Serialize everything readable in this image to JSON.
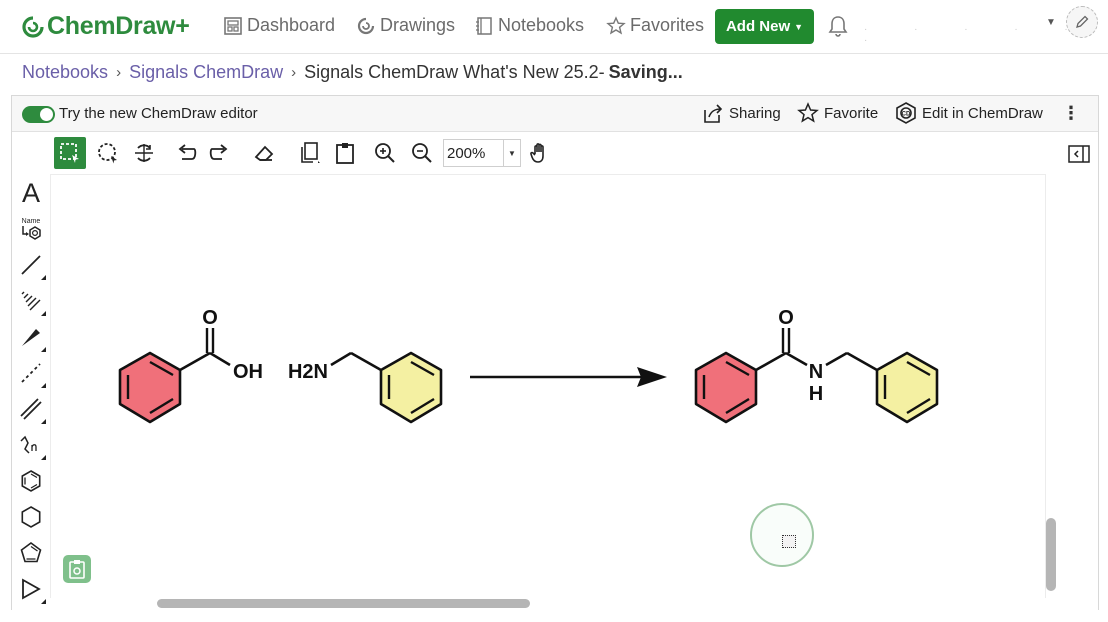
{
  "app": {
    "brand": "ChemDraw+",
    "brand_color": "#2e8b3e",
    "link_color": "#6a5fa8"
  },
  "nav": {
    "items": [
      {
        "label": "Dashboard",
        "icon": "dashboard-icon"
      },
      {
        "label": "Drawings",
        "icon": "drawings-icon"
      },
      {
        "label": "Notebooks",
        "icon": "notebook-icon"
      },
      {
        "label": "Favorites",
        "icon": "star-icon"
      }
    ],
    "add_new": "Add New",
    "add_new_color": "#218a2f"
  },
  "breadcrumb": {
    "items": [
      "Notebooks",
      "Signals ChemDraw"
    ],
    "current": "Signals ChemDraw What's New 25.2-",
    "status": "Saving..."
  },
  "editor_bar": {
    "toggle_label": "Try the new ChemDraw editor",
    "toggle_on": true,
    "sharing": "Sharing",
    "favorite": "Favorite",
    "edit_in": "Edit in ChemDraw"
  },
  "toolbar": {
    "zoom": "200%",
    "tools": [
      "marquee-select-icon",
      "lasso-select-icon",
      "rotate-icon",
      "undo-icon",
      "redo-icon",
      "eraser-icon",
      "copy-icon",
      "paste-icon",
      "zoom-in-icon",
      "zoom-out-icon",
      "hand-pan-icon"
    ]
  },
  "left_tools": {
    "text_tool": "A",
    "name_to_structure": "Name",
    "tools": [
      "text-tool-icon",
      "name-to-structure-icon",
      "single-bond-icon",
      "hashed-wedge-bond-icon",
      "wedge-bond-icon",
      "dashed-bond-icon",
      "double-bond-icon",
      "chain-tool-icon",
      "benzene-icon",
      "cyclohexane-icon",
      "cyclopentadiene-icon",
      "arrow-tool-icon"
    ]
  },
  "canvas": {
    "atom_labels": {
      "carbonyl_o_left": "O",
      "hydroxyl": "OH",
      "amine": "H2N",
      "carbonyl_o_right": "O",
      "amide_n": "N",
      "amide_h": "H"
    },
    "highlight_colors": {
      "red_ring": "#f0707a",
      "yellow_ring": "#f4f0a2"
    }
  }
}
